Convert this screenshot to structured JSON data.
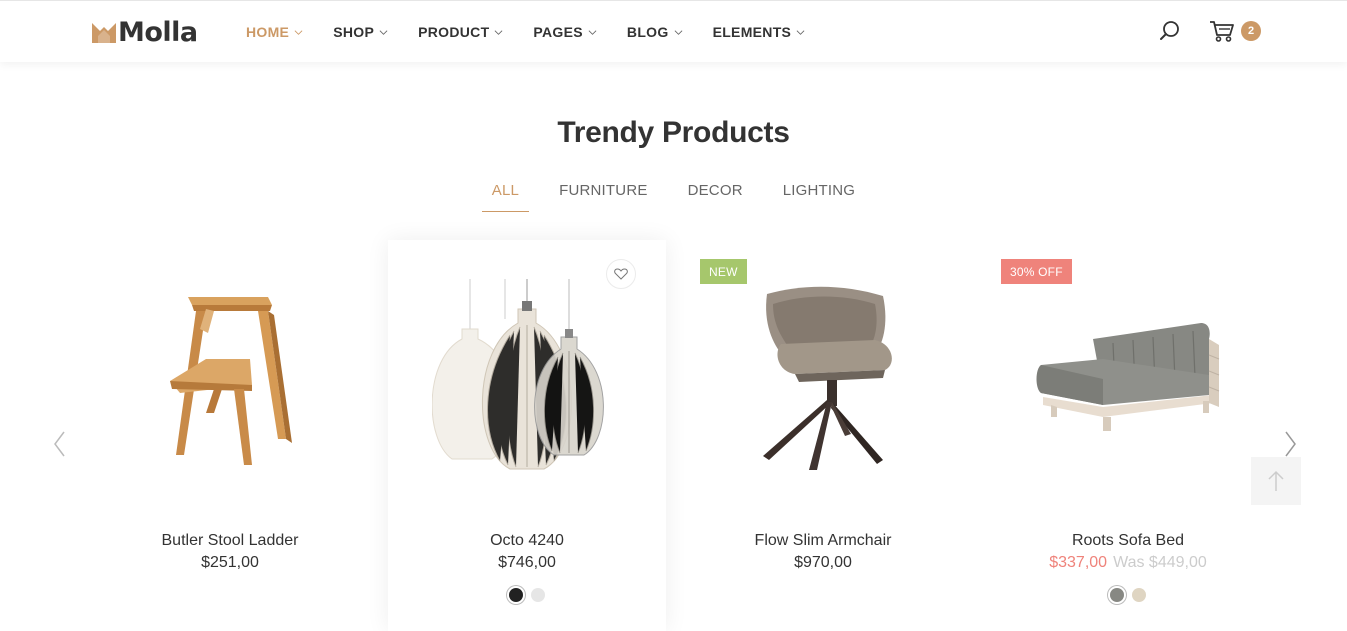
{
  "brand": {
    "name": "Molla",
    "accent": "#cc9966"
  },
  "nav": {
    "items": [
      {
        "label": "HOME",
        "active": true
      },
      {
        "label": "SHOP",
        "active": false
      },
      {
        "label": "PRODUCT",
        "active": false
      },
      {
        "label": "PAGES",
        "active": false
      },
      {
        "label": "BLOG",
        "active": false
      },
      {
        "label": "ELEMENTS",
        "active": false
      }
    ]
  },
  "header": {
    "search_icon": "search-icon",
    "cart_icon": "cart-icon",
    "cart_count": "2"
  },
  "section": {
    "title": "Trendy Products",
    "tabs": [
      {
        "label": "ALL",
        "active": true
      },
      {
        "label": "FURNITURE",
        "active": false
      },
      {
        "label": "DECOR",
        "active": false
      },
      {
        "label": "LIGHTING",
        "active": false
      }
    ]
  },
  "products": [
    {
      "name": "Butler Stool Ladder",
      "price": "$251,00",
      "image": "wooden-step-stool"
    },
    {
      "name": "Octo 4240",
      "price": "$746,00",
      "image": "pendant-lamps",
      "wishlist_icon": "heart-icon",
      "swatches": [
        {
          "color": "#222222",
          "selected": true
        },
        {
          "color": "#e6e6e6",
          "selected": false
        }
      ]
    },
    {
      "name": "Flow Slim Armchair",
      "price": "$970,00",
      "label": "NEW",
      "label_color": "#a6c76c",
      "image": "armchair"
    },
    {
      "name": "Roots Sofa Bed",
      "price_new": "$337,00",
      "price_old": "Was $449,00",
      "label": "30% OFF",
      "label_color": "#ef837b",
      "image": "sofa-bed",
      "swatches": [
        {
          "color": "#878883",
          "selected": true
        },
        {
          "color": "#dfd5c2",
          "selected": false
        }
      ]
    }
  ],
  "carousel": {
    "prev_icon": "chevron-left-icon",
    "next_icon": "chevron-right-icon"
  },
  "scroll_top_icon": "arrow-up-icon"
}
